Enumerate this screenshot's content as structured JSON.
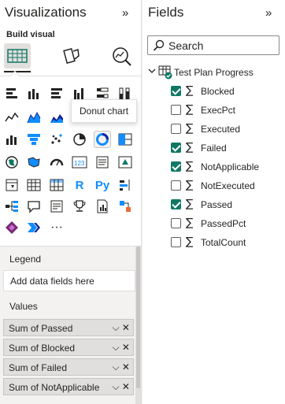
{
  "visualizations": {
    "title": "Visualizations",
    "collapse_glyph": "»",
    "build_visual_label": "Build visual",
    "build_tabs": [
      {
        "icon": "build-visual-grid-icon",
        "active": true
      },
      {
        "icon": "format-visual-icon",
        "active": false
      },
      {
        "icon": "analytics-magnifier-icon",
        "active": false
      }
    ],
    "tooltip": "Donut chart",
    "more_glyph": "···",
    "legend_label": "Legend",
    "legend_placeholder": "Add data fields here",
    "values_label": "Values",
    "values": [
      {
        "label": "Sum of Passed"
      },
      {
        "label": "Sum of Blocked"
      },
      {
        "label": "Sum of Failed"
      },
      {
        "label": "Sum of NotApplicable"
      }
    ],
    "value_controls": "⌵ ✕",
    "r_label": "R",
    "py_label": "Py"
  },
  "fields": {
    "title": "Fields",
    "collapse_glyph": "»",
    "search_placeholder": "Search",
    "table_name": "Test Plan Progress",
    "sigma": "∑",
    "items": [
      {
        "name": "Blocked",
        "checked": true
      },
      {
        "name": "ExecPct",
        "checked": false
      },
      {
        "name": "Executed",
        "checked": false
      },
      {
        "name": "Failed",
        "checked": true
      },
      {
        "name": "NotApplicable",
        "checked": true
      },
      {
        "name": "NotExecuted",
        "checked": false
      },
      {
        "name": "Passed",
        "checked": true
      },
      {
        "name": "PassedPct",
        "checked": false
      },
      {
        "name": "TotalCount",
        "checked": false
      }
    ]
  },
  "colors": {
    "accent_green": "#117865",
    "chart_blue": "#118dff",
    "chart_dark": "#12239e",
    "chart_orange": "#e66c37"
  }
}
